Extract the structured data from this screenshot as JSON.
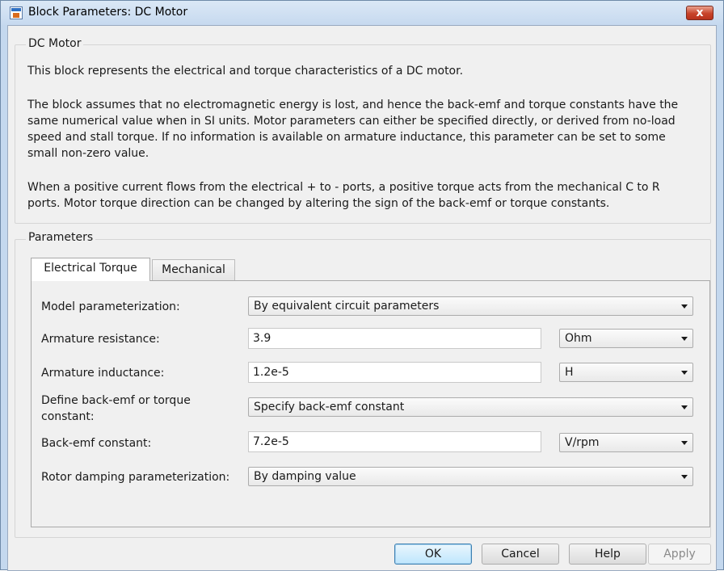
{
  "window": {
    "title": "Block Parameters: DC Motor",
    "close_glyph": "x",
    "icon": "simulink-block-icon"
  },
  "description_group": {
    "label": "DC Motor",
    "paragraphs": [
      "This block represents the electrical and torque characteristics of a DC motor.",
      "The block assumes that no electromagnetic energy is lost, and hence the back-emf and torque constants have the\nsame numerical value when in SI units. Motor parameters can either be specified directly, or derived from no-load\nspeed and stall torque. If no information is available on armature inductance, this parameter can be set to some\nsmall non-zero value.",
      "When a positive current flows from the electrical + to - ports, a positive torque acts from the mechanical C to R\nports. Motor torque direction can be changed by altering the sign of the back-emf or torque constants."
    ]
  },
  "parameters_group": {
    "label": "Parameters",
    "tabs": [
      {
        "label": "Electrical Torque",
        "active": true
      },
      {
        "label": "Mechanical",
        "active": false
      }
    ]
  },
  "fields": {
    "model_parameterization": {
      "label": "Model parameterization:",
      "value": "By equivalent circuit parameters"
    },
    "armature_resistance": {
      "label": "Armature resistance:",
      "value": "3.9",
      "unit": "Ohm"
    },
    "armature_inductance": {
      "label": "Armature inductance:",
      "value": "1.2e-5",
      "unit": "H"
    },
    "define_constant": {
      "label_line1": "Define back-emf or torque",
      "label_line2": "constant:",
      "value": "Specify back-emf constant"
    },
    "back_emf_constant": {
      "label": "Back-emf constant:",
      "value": "7.2e-5",
      "unit": "V/rpm"
    },
    "rotor_damping": {
      "label": "Rotor damping parameterization:",
      "value": "By damping value"
    }
  },
  "buttons": {
    "ok": "OK",
    "cancel": "Cancel",
    "help": "Help",
    "apply": "Apply"
  },
  "colors": {
    "frame": "#c4d8ee",
    "client_bg": "#f0f0f0",
    "close_button": "#c7432a",
    "default_button_border": "#3c7fb1"
  }
}
